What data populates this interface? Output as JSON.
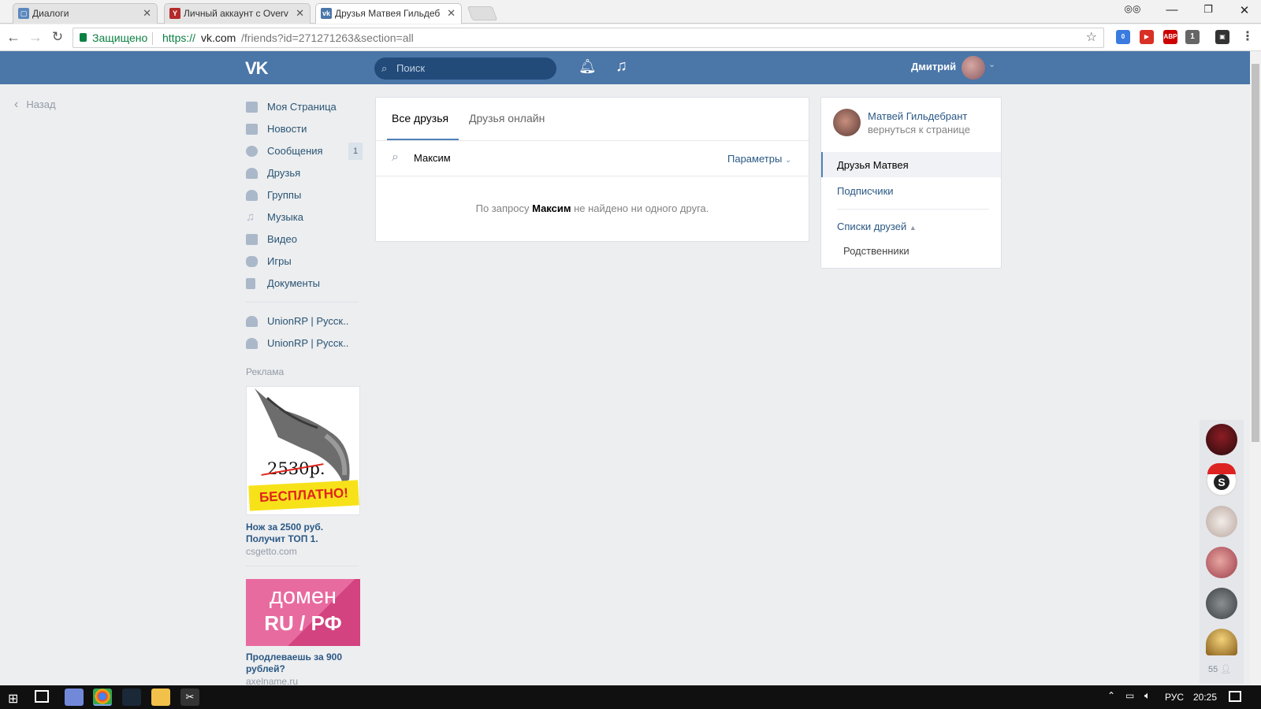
{
  "browser": {
    "tabs": [
      {
        "title": "Диалоги",
        "icon": "vk-icon",
        "active": false
      },
      {
        "title": "Личный аккаунт с Overv",
        "icon": "y-icon",
        "active": false
      },
      {
        "title": "Друзья Матвея Гильдеб",
        "icon": "vk-icon",
        "active": true
      }
    ],
    "secure_label": "Защищено",
    "url_scheme": "https://",
    "url_host": "vk.com",
    "url_path": "/friends?id=271271263&section=all",
    "ext_badge_1": "0",
    "ext_badge_2": "1"
  },
  "header": {
    "logo": "VK",
    "search_placeholder": "Поиск",
    "user_name": "Дмитрий"
  },
  "back_label": "Назад",
  "left_menu": {
    "items": [
      {
        "label": "Моя Страница",
        "icon": "home-icon"
      },
      {
        "label": "Новости",
        "icon": "news-icon"
      },
      {
        "label": "Сообщения",
        "icon": "messages-icon",
        "badge": "1"
      },
      {
        "label": "Друзья",
        "icon": "friends-icon"
      },
      {
        "label": "Группы",
        "icon": "groups-icon"
      },
      {
        "label": "Музыка",
        "icon": "music-icon"
      },
      {
        "label": "Видео",
        "icon": "video-icon"
      },
      {
        "label": "Игры",
        "icon": "games-icon"
      },
      {
        "label": "Документы",
        "icon": "documents-icon"
      }
    ],
    "groups": [
      {
        "label": "UnionRP | Русск.."
      },
      {
        "label": "UnionRP | Русск.."
      }
    ],
    "ads_title": "Реклама",
    "ad1": {
      "price": "2530р.",
      "banner": "БЕСПЛАТНО!",
      "title_line1": "Нож за 2500 руб.",
      "title_line2": "Получит ТОП 1.",
      "domain": "csgetto.com"
    },
    "ad2": {
      "line1": "домен",
      "line2": "RU / РФ",
      "title_line1": "Продлеваешь за 900",
      "title_line2": "рублей?",
      "domain": "axelname.ru"
    }
  },
  "friends": {
    "tabs": [
      "Все друзья",
      "Друзья онлайн"
    ],
    "search_value": "Максим",
    "params_label": "Параметры",
    "empty_prefix": "По запросу ",
    "empty_query": "Максим",
    "empty_suffix": " не найдено ни одного друга."
  },
  "right_col": {
    "owner_name": "Матвей Гильдебрант",
    "back_to_page": "вернуться к странице",
    "items": [
      "Друзья Матвея",
      "Подписчики"
    ],
    "lists_label": "Списки друзей",
    "sub_items": [
      "Родственники"
    ]
  },
  "online": {
    "count": "55"
  },
  "taskbar": {
    "lang": "РУС",
    "time": "20:25"
  },
  "colors": {
    "vk_blue": "#4a76a8",
    "link": "#2a5885",
    "ad_pink": "#e0508a",
    "ad_yellow": "#f7e21a"
  }
}
